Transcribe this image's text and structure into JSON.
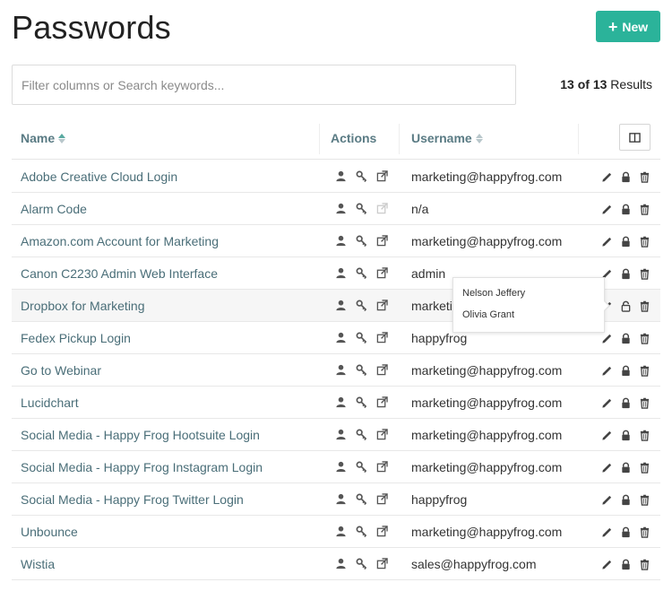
{
  "header": {
    "title": "Passwords",
    "new_button_label": "New"
  },
  "search": {
    "placeholder": "Filter columns or Search keywords...",
    "value": ""
  },
  "results": {
    "shown": "13",
    "of_label": " of ",
    "total": "13",
    "suffix": " Results"
  },
  "table": {
    "columns": {
      "name": "Name",
      "actions": "Actions",
      "username": "Username"
    },
    "rows": [
      {
        "name": "Adobe Creative Cloud Login",
        "username": "marketing@happyfrog.com",
        "link_enabled": true
      },
      {
        "name": "Alarm Code",
        "username": "n/a",
        "link_enabled": false
      },
      {
        "name": "Amazon.com Account for Marketing",
        "username": "marketing@happyfrog.com",
        "link_enabled": true
      },
      {
        "name": "Canon C2230 Admin Web Interface",
        "username": "admin",
        "link_enabled": true
      },
      {
        "name": "Dropbox for Marketing",
        "username": "marketing@happyfrog.com",
        "link_enabled": true
      },
      {
        "name": "Fedex Pickup Login",
        "username": "happyfrog",
        "link_enabled": true
      },
      {
        "name": "Go to Webinar",
        "username": "marketing@happyfrog.com",
        "link_enabled": true
      },
      {
        "name": "Lucidchart",
        "username": "marketing@happyfrog.com",
        "link_enabled": true
      },
      {
        "name": "Social Media - Happy Frog Hootsuite Login",
        "username": "marketing@happyfrog.com",
        "link_enabled": true
      },
      {
        "name": "Social Media - Happy Frog Instagram Login",
        "username": "marketing@happyfrog.com",
        "link_enabled": true
      },
      {
        "name": "Social Media - Happy Frog Twitter Login",
        "username": "happyfrog",
        "link_enabled": true
      },
      {
        "name": "Unbounce",
        "username": "marketing@happyfrog.com",
        "link_enabled": true
      },
      {
        "name": "Wistia",
        "username": "sales@happyfrog.com",
        "link_enabled": true
      }
    ],
    "row_icons": [
      "user-icon",
      "key-icon",
      "external-link-icon"
    ],
    "row_ops_icons": [
      "pencil-icon",
      "lock-icon",
      "trash-icon"
    ]
  },
  "popover": {
    "items": [
      "Nelson Jeffery",
      "Olivia Grant"
    ]
  },
  "colors": {
    "accent": "#2bb39a",
    "link": "#4a6e78",
    "header_text": "#5a7b84"
  }
}
